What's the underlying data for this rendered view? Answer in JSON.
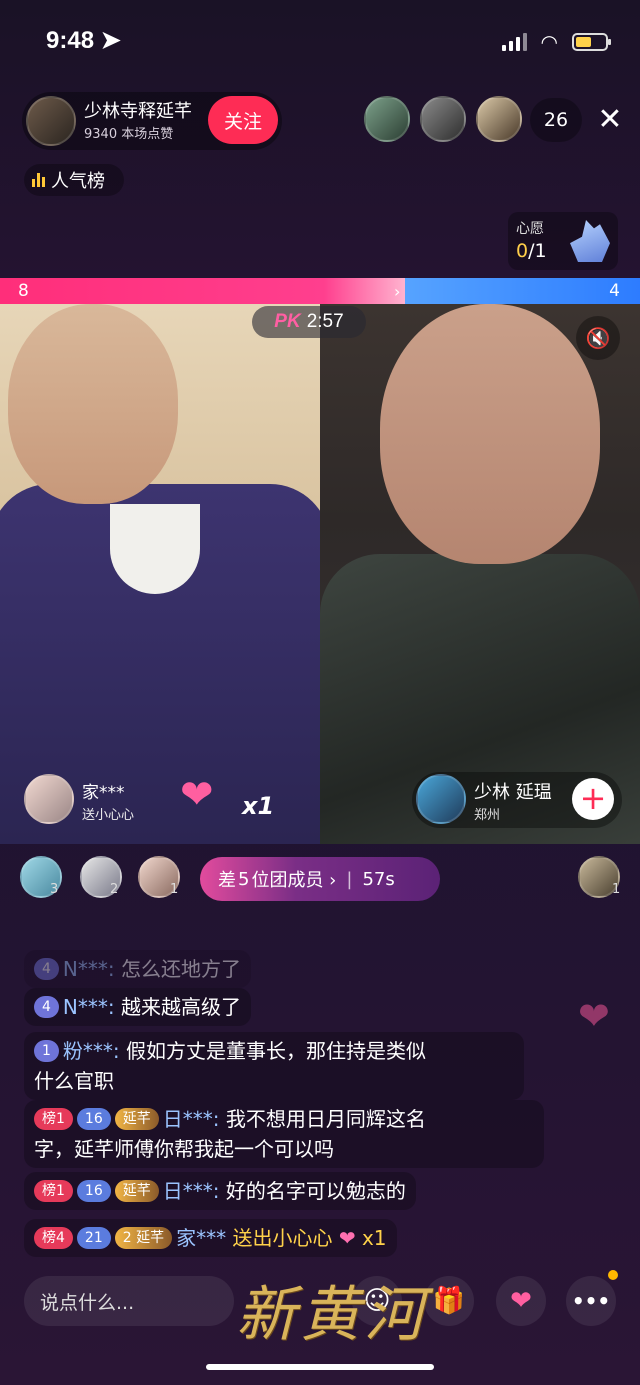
{
  "status": {
    "time": "9:48"
  },
  "host": {
    "name": "少林寺释延芊",
    "likes": "9340 本场点赞",
    "follow_label": "关注"
  },
  "viewers": {
    "count": "26"
  },
  "rank": {
    "label": "人气榜"
  },
  "wish": {
    "title": "心愿",
    "done": "0",
    "total": "/1"
  },
  "pk": {
    "left_score": "8",
    "right_score": "4",
    "logo": "PK",
    "timer": "2:57"
  },
  "left_gift": {
    "user": "家***",
    "text": "送小心心",
    "multiplier": "x1"
  },
  "opponent": {
    "name": "少林 延瑥",
    "location": "郑州"
  },
  "fans": [
    {
      "rank": "3"
    },
    {
      "rank": "2"
    },
    {
      "rank": "1"
    }
  ],
  "team": {
    "prefix": "差",
    "count": "5",
    "text": "位团成员 ›",
    "timer": "57s"
  },
  "right_fan": {
    "rank": "1"
  },
  "comments": [
    {
      "badge": "4",
      "user": "N***:",
      "text": "怎么还地方了"
    },
    {
      "badge": "4",
      "user": "N***:",
      "text": "越来越高级了"
    },
    {
      "badge": "1",
      "user": "粉***:",
      "text": "假如方丈是董事长，那住持是类似",
      "text2": "什么官职"
    },
    {
      "rank_badge": "榜1",
      "level": "16",
      "club": "延芊",
      "user": "日***:",
      "text": "我不想用日月同辉这名",
      "text2": "字，延芊师傅你帮我起一个可以吗"
    },
    {
      "rank_badge": "榜1",
      "level": "16",
      "club": "延芊",
      "user": "日***:",
      "text": "好的名字可以勉志的"
    },
    {
      "rank_badge": "榜4",
      "level": "21",
      "club": "延芊",
      "club_level": "2",
      "user": "家***",
      "text": "送出小心心",
      "multiplier": "x1"
    }
  ],
  "bottom": {
    "input_placeholder": "说点什么...",
    "more_label": "•••"
  },
  "watermark": "新黄河",
  "colors": {
    "accent": "#fe2c55",
    "pk_red": "#ff2e7a",
    "pk_blue": "#2d7cff",
    "gold": "#ffd24a"
  }
}
